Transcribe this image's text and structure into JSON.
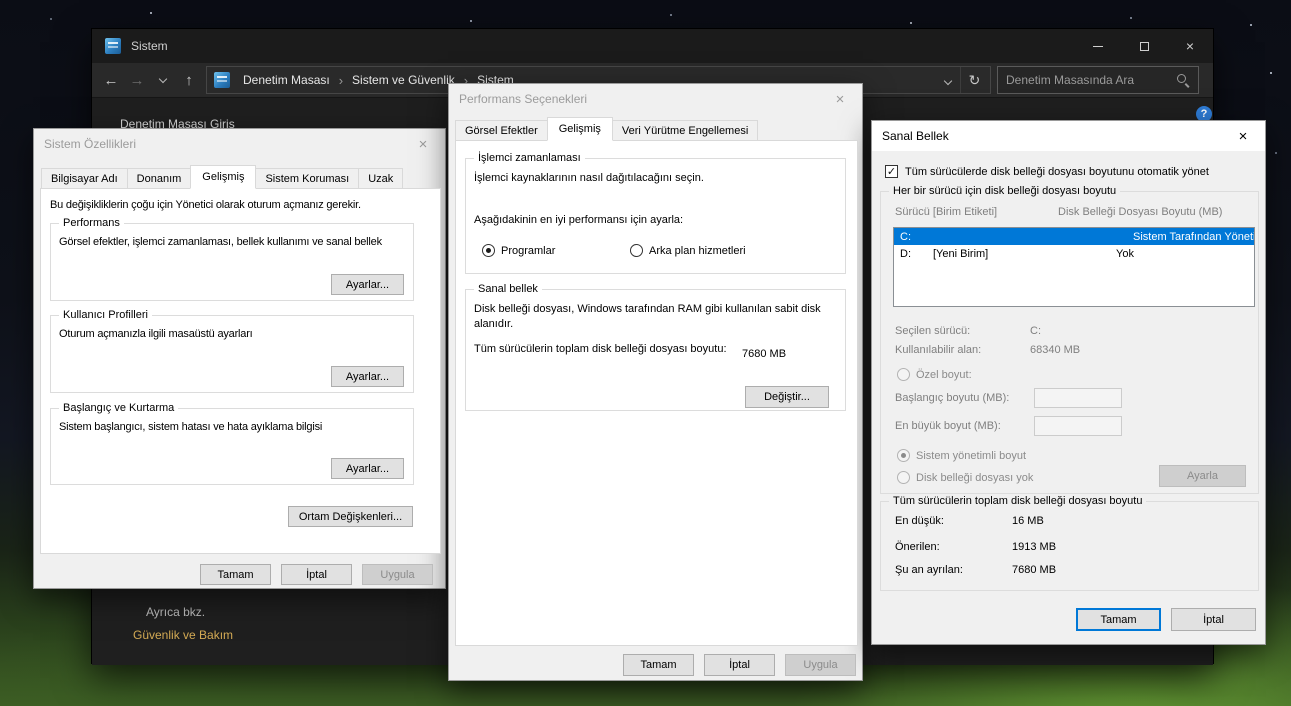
{
  "icons": {
    "back": "←",
    "forward": "→",
    "up": "↑",
    "refresh": "↻",
    "close": "×",
    "crumb_sep": "›",
    "check": "✓",
    "help": "?"
  },
  "colors": {
    "accent": "#0078d7",
    "selection": "#0078d7",
    "link_gold": "#d5ab55",
    "titlebar_dark": "#1b1b1b"
  },
  "window": {
    "title": "Sistem",
    "crumbs": [
      "Denetim Masası",
      "Sistem ve Güvenlik",
      "Sistem"
    ],
    "search_placeholder": "Denetim Masasında Ara",
    "home_link": "Denetim Masası Giriş",
    "see_also": "Ayrıca bkz.",
    "see_also_link": "Güvenlik ve Bakım"
  },
  "sysprops": {
    "title": "Sistem Özellikleri",
    "tabs": [
      "Bilgisayar Adı",
      "Donanım",
      "Gelişmiş",
      "Sistem Koruması",
      "Uzak"
    ],
    "note": "Bu değişikliklerin çoğu için Yönetici olarak oturum açmanız gerekir.",
    "groups": [
      {
        "title": "Performans",
        "desc": "Görsel efektler, işlemci zamanlaması, bellek kullanımı ve sanal bellek",
        "button": "Ayarlar..."
      },
      {
        "title": "Kullanıcı Profilleri",
        "desc": "Oturum açmanızla ilgili masaüstü ayarları",
        "button": "Ayarlar..."
      },
      {
        "title": "Başlangıç ve Kurtarma",
        "desc": "Sistem başlangıcı, sistem hatası ve hata ayıklama bilgisi",
        "button": "Ayarlar..."
      }
    ],
    "env_button": "Ortam Değişkenleri...",
    "ok": "Tamam",
    "cancel": "İptal",
    "apply": "Uygula"
  },
  "perf": {
    "title": "Performans Seçenekleri",
    "tabs": [
      "Görsel Efektler",
      "Gelişmiş",
      "Veri Yürütme Engellemesi"
    ],
    "sched_title": "İşlemci zamanlaması",
    "sched_desc": "İşlemci kaynaklarının nasıl dağıtılacağını seçin.",
    "sched_prompt": "Aşağıdakinin en iyi performansı için ayarla:",
    "radio_programs": "Programlar",
    "radio_background": "Arka plan hizmetleri",
    "vm_title": "Sanal bellek",
    "vm_desc": "Disk belleği dosyası, Windows tarafından RAM gibi kullanılan sabit disk alanıdır.",
    "vm_total_label": "Tüm sürücülerin toplam disk belleği dosyası boyutu:",
    "vm_total_value": "7680 MB",
    "change_button": "Değiştir...",
    "ok": "Tamam",
    "cancel": "İptal",
    "apply": "Uygula"
  },
  "vmem": {
    "title": "Sanal Bellek",
    "auto_manage": "Tüm sürücülerde disk belleği dosyası boyutunu otomatik yönet",
    "group_drives": "Her bir sürücü için disk belleği dosyası boyutu",
    "col_drive": "Sürücü  [Birim Etiketi]",
    "col_size": "Disk Belleği Dosyası Boyutu (MB)",
    "rows": [
      {
        "drive": "C:",
        "volume": "",
        "size": "Sistem Tarafından Yönetilen"
      },
      {
        "drive": "D:",
        "volume": "[Yeni Birim]",
        "size": "Yok"
      }
    ],
    "selected_drive_label": "Seçilen sürücü:",
    "selected_drive_value": "C:",
    "space_label": "Kullanılabilir alan:",
    "space_value": "68340 MB",
    "custom_size": "Özel boyut:",
    "initial_size": "Başlangıç boyutu (MB):",
    "max_size": "En büyük boyut (MB):",
    "system_managed": "Sistem yönetimli boyut",
    "no_pagefile": "Disk belleği dosyası yok",
    "set_button": "Ayarla",
    "group_total": "Tüm sürücülerin toplam disk belleği dosyası boyutu",
    "min_label": "En düşük:",
    "min_value": "16 MB",
    "rec_label": "Önerilen:",
    "rec_value": "1913 MB",
    "cur_label": "Şu an ayrılan:",
    "cur_value": "7680 MB",
    "ok": "Tamam",
    "cancel": "İptal"
  }
}
